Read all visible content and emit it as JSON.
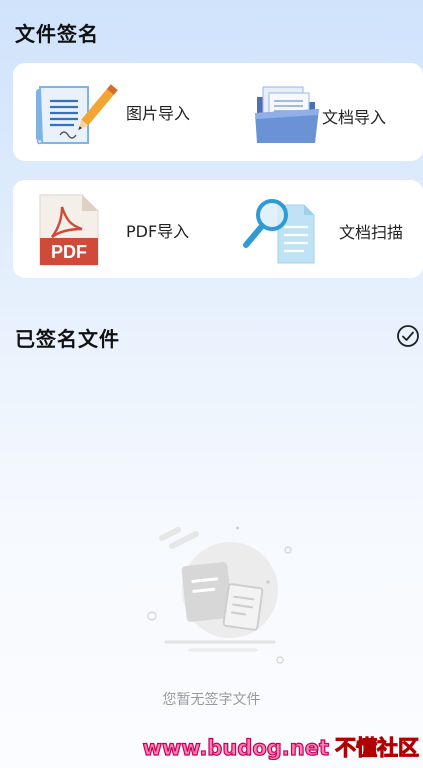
{
  "header": {
    "title": "文件签名"
  },
  "import_options": [
    {
      "label": "图片导入",
      "icon": "paper-quill-icon"
    },
    {
      "label": "文档导入",
      "icon": "folder-documents-icon"
    },
    {
      "label": "PDF导入",
      "icon": "pdf-file-icon"
    },
    {
      "label": "文档扫描",
      "icon": "magnifier-document-icon"
    }
  ],
  "pdf_badge_text": "PDF",
  "signed_section": {
    "title": "已签名文件",
    "action_icon": "check-circle-icon"
  },
  "empty_state": {
    "text": "您暂无签字文件",
    "icon": "empty-documents-illustration"
  },
  "watermark": {
    "url": "www.budog.net",
    "name": "不懂社区"
  },
  "colors": {
    "accent": "#1e88e5",
    "card_bg": "#ffffff",
    "pdf_red": "#d04a3a"
  }
}
